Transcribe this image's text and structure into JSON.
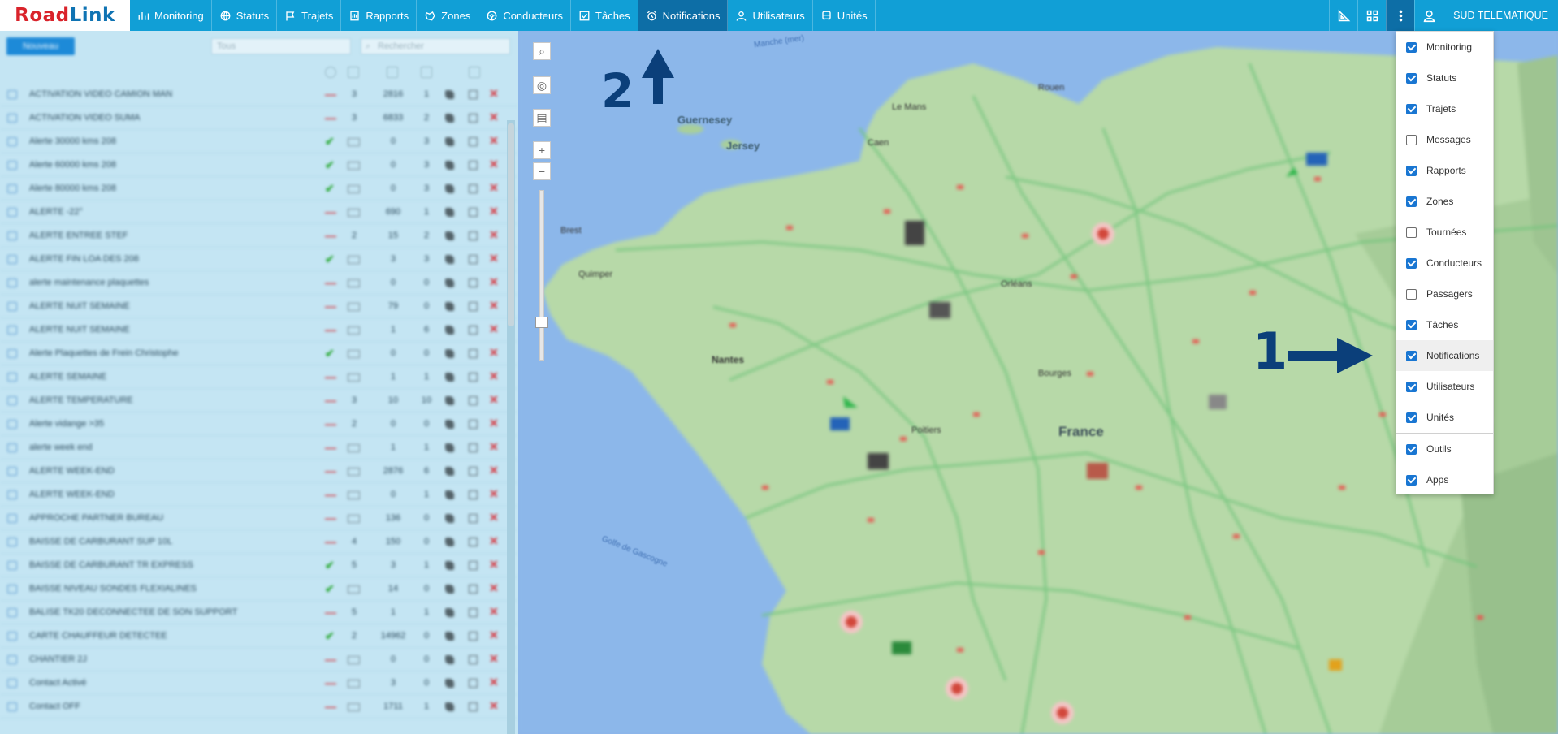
{
  "app": {
    "logo_road": "Road",
    "logo_link": "Link"
  },
  "nav": [
    {
      "label": "Monitoring",
      "icon": "bar-chart-icon",
      "active": false
    },
    {
      "label": "Statuts",
      "icon": "globe-icon",
      "active": false
    },
    {
      "label": "Trajets",
      "icon": "flag-icon",
      "active": false
    },
    {
      "label": "Rapports",
      "icon": "report-icon",
      "active": false
    },
    {
      "label": "Zones",
      "icon": "zone-icon",
      "active": false
    },
    {
      "label": "Conducteurs",
      "icon": "steering-wheel-icon",
      "active": false
    },
    {
      "label": "Tâches",
      "icon": "checklist-icon",
      "active": false
    },
    {
      "label": "Notifications",
      "icon": "alarm-clock-icon",
      "active": true
    },
    {
      "label": "Utilisateurs",
      "icon": "user-icon",
      "active": false
    },
    {
      "label": "Unités",
      "icon": "bus-icon",
      "active": false
    }
  ],
  "toolbar_right": {
    "company": "SUD TELEMATIQUE"
  },
  "panel": {
    "new_button": "Nouveau",
    "filter_select": "Tous",
    "search_placeholder": "Rechercher",
    "rows": [
      {
        "name": "ACTIVATION VIDEO CAMION MAN",
        "status": "dash",
        "c1": "3",
        "c2": "2816",
        "c3": "1"
      },
      {
        "name": "ACTIVATION VIDEO SUMA",
        "status": "dash",
        "c1": "3",
        "c2": "6833",
        "c3": "2"
      },
      {
        "name": "Alerte 30000 kms 208",
        "status": "check",
        "c1": "",
        "c2": "0",
        "c3": "3"
      },
      {
        "name": "Alerte 60000 kms 208",
        "status": "check",
        "c1": "",
        "c2": "0",
        "c3": "3"
      },
      {
        "name": "Alerte 80000 kms 208",
        "status": "check",
        "c1": "",
        "c2": "0",
        "c3": "3"
      },
      {
        "name": "ALERTE -22°",
        "status": "dash",
        "c1": "",
        "c2": "690",
        "c3": "1"
      },
      {
        "name": "ALERTE ENTREE STEF",
        "status": "dash",
        "c1": "2",
        "c2": "15",
        "c3": "2"
      },
      {
        "name": "ALERTE FIN LOA DES 208",
        "status": "check",
        "c1": "",
        "c2": "3",
        "c3": "3"
      },
      {
        "name": "alerte maintenance plaquettes",
        "status": "dash",
        "c1": "",
        "c2": "0",
        "c3": "0"
      },
      {
        "name": "ALERTE NUIT SEMAINE",
        "status": "dash",
        "c1": "",
        "c2": "79",
        "c3": "0"
      },
      {
        "name": "ALERTE NUIT SEMAINE",
        "status": "dash",
        "c1": "",
        "c2": "1",
        "c3": "6"
      },
      {
        "name": "Alerte Plaquettes de Frein Christophe",
        "status": "check",
        "c1": "",
        "c2": "0",
        "c3": "0"
      },
      {
        "name": "ALERTE SEMAINE",
        "status": "dash",
        "c1": "",
        "c2": "1",
        "c3": "1"
      },
      {
        "name": "ALERTE TEMPERATURE",
        "status": "dash",
        "c1": "3",
        "c2": "10",
        "c3": "10"
      },
      {
        "name": "Alerte vidange >35",
        "status": "dash",
        "c1": "2",
        "c2": "0",
        "c3": "0"
      },
      {
        "name": "alerte week end",
        "status": "dash",
        "c1": "",
        "c2": "1",
        "c3": "1"
      },
      {
        "name": "ALERTE WEEK-END",
        "status": "dash",
        "c1": "",
        "c2": "2876",
        "c3": "6"
      },
      {
        "name": "ALERTE WEEK-END",
        "status": "dash",
        "c1": "",
        "c2": "0",
        "c3": "1"
      },
      {
        "name": "APPROCHE PARTNER BUREAU",
        "status": "dash",
        "c1": "",
        "c2": "136",
        "c3": "0"
      },
      {
        "name": "BAISSE DE CARBURANT SUP 10L",
        "status": "dash",
        "c1": "4",
        "c2": "150",
        "c3": "0"
      },
      {
        "name": "BAISSE DE CARBURANT TR EXPRESS",
        "status": "check",
        "c1": "5",
        "c2": "3",
        "c3": "1"
      },
      {
        "name": "BAISSE NIVEAU SONDES FLEXIALINES",
        "status": "check",
        "c1": "",
        "c2": "14",
        "c3": "0"
      },
      {
        "name": "BALISE TK20 DECONNECTEE DE SON SUPPORT",
        "status": "dash",
        "c1": "5",
        "c2": "1",
        "c3": "1"
      },
      {
        "name": "CARTE CHAUFFEUR DETECTEE",
        "status": "check",
        "c1": "2",
        "c2": "14962",
        "c3": "0"
      },
      {
        "name": "CHANTIER 2J",
        "status": "dash",
        "c1": "",
        "c2": "0",
        "c3": "0"
      },
      {
        "name": "Contact Activé",
        "status": "dash",
        "c1": "",
        "c2": "3",
        "c3": "0"
      },
      {
        "name": "Contact OFF",
        "status": "dash",
        "c1": "",
        "c2": "1711",
        "c3": "1"
      }
    ]
  },
  "map": {
    "labels": {
      "guernesey": "Guernesey",
      "jersey": "Jersey",
      "france": "France",
      "manche": "Manche (mer)",
      "golfe": "Golfe de Gascogne",
      "nantes": "Nantes",
      "brest": "Brest",
      "quimper": "Quimper",
      "poitiers": "Poitiers",
      "orleans": "Orléans",
      "bourges": "Bourges",
      "le_mans": "Le Mans",
      "caen": "Caen",
      "rouen": "Rouen"
    },
    "annotation_1": "1",
    "annotation_2": "2"
  },
  "dropdown": {
    "items": [
      {
        "label": "Monitoring",
        "checked": true
      },
      {
        "label": "Statuts",
        "checked": true
      },
      {
        "label": "Trajets",
        "checked": true
      },
      {
        "label": "Messages",
        "checked": false
      },
      {
        "label": "Rapports",
        "checked": true
      },
      {
        "label": "Zones",
        "checked": true
      },
      {
        "label": "Tournées",
        "checked": false
      },
      {
        "label": "Conducteurs",
        "checked": true
      },
      {
        "label": "Passagers",
        "checked": false
      },
      {
        "label": "Tâches",
        "checked": true
      },
      {
        "label": "Notifications",
        "checked": true,
        "hover": true
      },
      {
        "label": "Utilisateurs",
        "checked": true
      },
      {
        "label": "Unités",
        "checked": true
      }
    ],
    "extra_items": [
      {
        "label": "Outils",
        "checked": true
      },
      {
        "label": "Apps",
        "checked": true
      }
    ]
  },
  "colors": {
    "topbar": "#119fd6",
    "active_tab": "#0d6ea6",
    "checkbox": "#1976d2",
    "annotation": "#0b3f7a"
  }
}
